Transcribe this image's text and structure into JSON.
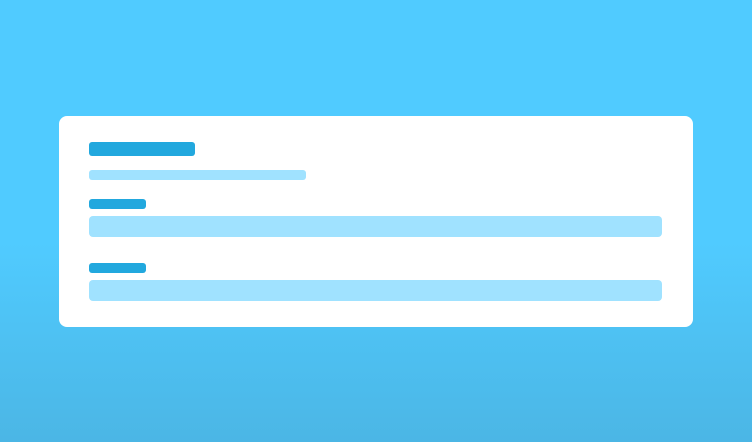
{
  "colors": {
    "background_top": "#50CBFF",
    "background_bottom": "#4BB6E5",
    "card": "#FFFFFF",
    "placeholder_dark": "#22A8DE",
    "placeholder_light": "#A0E2FF"
  },
  "form": {
    "title": "",
    "subtitle": "",
    "fields": [
      {
        "label": "",
        "value": ""
      },
      {
        "label": "",
        "value": ""
      }
    ]
  }
}
